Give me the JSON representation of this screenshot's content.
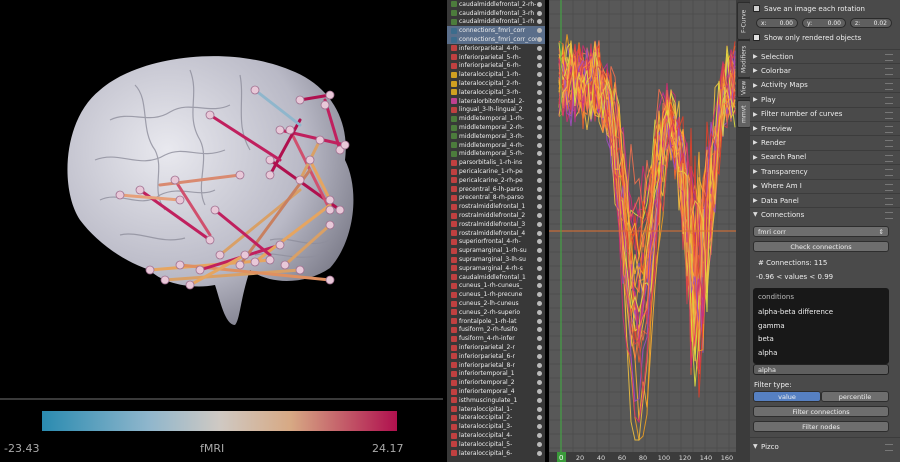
{
  "viewport": {
    "colorbar": {
      "min_label": "-23.43",
      "title": "fMRI",
      "max_label": "24.17"
    }
  },
  "outliner": {
    "items": [
      {
        "label": "caudalmiddlefrontal_2-rh-",
        "color": "#4c7c3c"
      },
      {
        "label": "caudalmiddlefrontal_3-rh",
        "color": "#4c7c3c"
      },
      {
        "label": "caudalmiddlefrontal_1-rh",
        "color": "#4c7c3c"
      },
      {
        "label": "connections_fmri_corr",
        "color": "#3c6c8c"
      },
      {
        "label": "connections_fmri_corr_connections",
        "color": "#3c6c8c"
      },
      {
        "label": "inferiorparietal_4-rh-",
        "color": "#c04040"
      },
      {
        "label": "inferiorparietal_5-rh-",
        "color": "#c04040"
      },
      {
        "label": "inferiorparietal_6-rh-",
        "color": "#c04040"
      },
      {
        "label": "lateraloccipital_1-rh-",
        "color": "#d0a020"
      },
      {
        "label": "lateraloccipital_2-rh-",
        "color": "#d0a020"
      },
      {
        "label": "lateraloccipital_3-rh-",
        "color": "#d0a020"
      },
      {
        "label": "lateralorbitofrontal_2-",
        "color": "#c04090"
      },
      {
        "label": "lingual_3-lh-lingual_2",
        "color": "#c04040"
      },
      {
        "label": "middletemporal_1-rh-",
        "color": "#4c7c3c"
      },
      {
        "label": "middletemporal_2-rh-",
        "color": "#4c7c3c"
      },
      {
        "label": "middletemporal_3-rh-",
        "color": "#4c7c3c"
      },
      {
        "label": "middletemporal_4-rh-",
        "color": "#4c7c3c"
      },
      {
        "label": "middletemporal_5-rh-",
        "color": "#4c7c3c"
      },
      {
        "label": "parsorbitalis_1-rh-ins",
        "color": "#c04040"
      },
      {
        "label": "pericalcarine_1-rh-pe",
        "color": "#c04040"
      },
      {
        "label": "pericalcarine_2-rh-pe",
        "color": "#c04040"
      },
      {
        "label": "precentral_6-lh-parso",
        "color": "#c04040"
      },
      {
        "label": "precentral_8-rh-parso",
        "color": "#c04040"
      },
      {
        "label": "rostralmiddlefrontal_1",
        "color": "#c04040"
      },
      {
        "label": "rostralmiddlefrontal_2",
        "color": "#c04040"
      },
      {
        "label": "rostralmiddlefrontal_3",
        "color": "#c04040"
      },
      {
        "label": "rostralmiddlefrontal_4",
        "color": "#c04040"
      },
      {
        "label": "superiorfrontal_4-rh-",
        "color": "#c04040"
      },
      {
        "label": "supramarginal_1-rh-su",
        "color": "#c04040"
      },
      {
        "label": "supramarginal_3-lh-su",
        "color": "#c04040"
      },
      {
        "label": "supramarginal_4-rh-s",
        "color": "#c04040"
      },
      {
        "label": "caudalmiddlefrontal_1",
        "color": "#c04040"
      },
      {
        "label": "cuneus_1-rh-cuneus_",
        "color": "#c04040"
      },
      {
        "label": "cuneus_1-rh-precune",
        "color": "#c04040"
      },
      {
        "label": "cuneus_2-lh-cuneus",
        "color": "#c04040"
      },
      {
        "label": "cuneus_2-rh-superio",
        "color": "#c04040"
      },
      {
        "label": "frontalpole_1-rh-lat",
        "color": "#c04040"
      },
      {
        "label": "fusiform_2-rh-fusifo",
        "color": "#c04040"
      },
      {
        "label": "fusiform_4-rh-infer",
        "color": "#c04040"
      },
      {
        "label": "inferiorparietal_2-r",
        "color": "#c04040"
      },
      {
        "label": "inferiorparietal_6-r",
        "color": "#c04040"
      },
      {
        "label": "inferiorparietal_8-r",
        "color": "#c04040"
      },
      {
        "label": "inferiortemporal_1",
        "color": "#c04040"
      },
      {
        "label": "inferiortemporal_2",
        "color": "#c04040"
      },
      {
        "label": "inferiortemporal_4",
        "color": "#c04040"
      },
      {
        "label": "isthmuscingulate_1",
        "color": "#c04040"
      },
      {
        "label": "lateraloccipital_1-",
        "color": "#c04040"
      },
      {
        "label": "lateraloccipital_2-",
        "color": "#c04040"
      },
      {
        "label": "lateraloccipital_3-",
        "color": "#c04040"
      },
      {
        "label": "lateraloccipital_4-",
        "color": "#c04040"
      },
      {
        "label": "lateraloccipital_5-",
        "color": "#c04040"
      },
      {
        "label": "lateraloccipital_6-",
        "color": "#c04040"
      }
    ]
  },
  "graph": {
    "x_ticks": [
      "0",
      "20",
      "40",
      "60",
      "80",
      "100",
      "120",
      "140",
      "160"
    ],
    "frame_label": "0"
  },
  "sidetabs": {
    "curve": "F-Curve",
    "modifiers": "Modifiers",
    "view": "View",
    "mmvt": "mmvt"
  },
  "panel": {
    "save_image_label": "Save an image each rotation",
    "rot_x_label": "x:",
    "rot_x_value": "0.00",
    "rot_y_label": "y:",
    "rot_y_value": "0.00",
    "rot_z_label": "z:",
    "rot_z_value": "0.02",
    "show_rendered_label": "Show only rendered objects",
    "sections": [
      "Selection",
      "Colorbar",
      "Activity Maps",
      "Play",
      "Filter number of curves",
      "Freeview",
      "Render",
      "Search Panel",
      "Transparency",
      "Where Am I",
      "Data Panel"
    ],
    "connections": {
      "header": "Connections",
      "dataset_value": "fmri corr",
      "check_button": "Check connections",
      "count_text": "# Connections: 115",
      "range_text": "-0.96 < values < 0.99",
      "conditions_header": "conditions",
      "conditions": [
        "alpha-beta difference",
        "gamma",
        "beta",
        "alpha"
      ],
      "selected_condition": "alpha",
      "filter_type_label": "Filter type:",
      "filter_value": "value",
      "filter_percentile": "percentile",
      "filter_connections_button": "Filter connections",
      "filter_nodes_button": "Filter nodes"
    },
    "pizco_header": "Pizco"
  }
}
